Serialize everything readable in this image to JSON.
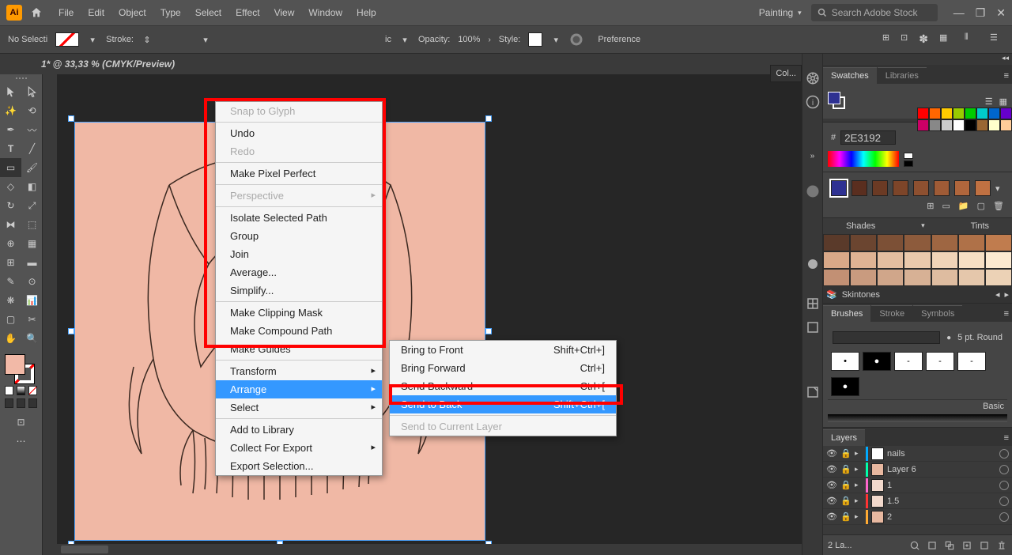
{
  "menubar": {
    "app_abbrev": "Ai",
    "menus": [
      "File",
      "Edit",
      "Object",
      "Type",
      "Select",
      "Effect",
      "View",
      "Window",
      "Help"
    ],
    "workspace": "Painting",
    "stock_placeholder": "Search Adobe Stock"
  },
  "control_bar": {
    "selection_label": "No Selecti",
    "stroke_label": "Stroke:",
    "opacity_label": "Opacity:",
    "opacity_value": "100%",
    "style_label": "Style:",
    "prefs_label": "Preference",
    "partial_ic": "ic"
  },
  "doc_tab": "1* @ 33,33 % (CMYK/Preview)",
  "context_menu": {
    "items": [
      {
        "label": "Snap to Glyph",
        "disabled": true
      },
      {
        "sep": true
      },
      {
        "label": "Undo"
      },
      {
        "label": "Redo",
        "disabled": true
      },
      {
        "sep": true
      },
      {
        "label": "Make Pixel Perfect"
      },
      {
        "sep": true
      },
      {
        "label": "Perspective",
        "disabled": true,
        "sub": true
      },
      {
        "sep": true
      },
      {
        "label": "Isolate Selected Path"
      },
      {
        "label": "Group"
      },
      {
        "label": "Join"
      },
      {
        "label": "Average..."
      },
      {
        "label": "Simplify..."
      },
      {
        "sep": true
      },
      {
        "label": "Make Clipping Mask"
      },
      {
        "label": "Make Compound Path"
      },
      {
        "label": "Make Guides"
      },
      {
        "sep": true
      },
      {
        "label": "Transform",
        "sub": true
      },
      {
        "label": "Arrange",
        "sub": true,
        "hl": true
      },
      {
        "label": "Select",
        "sub": true
      },
      {
        "sep": true
      },
      {
        "label": "Add to Library"
      },
      {
        "label": "Collect For Export",
        "sub": true
      },
      {
        "label": "Export Selection..."
      }
    ],
    "submenu": [
      {
        "label": "Bring to Front",
        "shortcut": "Shift+Ctrl+]"
      },
      {
        "label": "Bring Forward",
        "shortcut": "Ctrl+]"
      },
      {
        "label": "Send Backward",
        "shortcut": "Ctrl+["
      },
      {
        "label": "Send to Back",
        "shortcut": "Shift+Ctrl+[",
        "hl": true
      },
      {
        "sep": true
      },
      {
        "label": "Send to Current Layer",
        "disabled": true
      }
    ]
  },
  "color_tab_partial": "Col...",
  "panels": {
    "swatches": {
      "tab1": "Swatches",
      "tab2": "Libraries"
    },
    "color": {
      "hash": "#",
      "hex": "2E3192"
    },
    "gradient_colors": [
      "#2E3192",
      "#5a2e1f",
      "#6b3a24",
      "#7d4529",
      "#8e5030",
      "#9f5b36",
      "#b0663c",
      "#c07142"
    ],
    "shades": {
      "tab1": "Shades",
      "tab2": "Tints",
      "footer_label": "Skintones"
    },
    "brushes": {
      "tab1": "Brushes",
      "tab2": "Stroke",
      "tab3": "Symbols",
      "size": "5 pt. Round",
      "basic_label": "Basic"
    },
    "layers": {
      "tab": "Layers",
      "rows": [
        {
          "name": "nails",
          "color": "#00aaff",
          "thumb": "#fff"
        },
        {
          "name": "Layer 6",
          "color": "#00ffaa",
          "thumb": "#e8b8a0"
        },
        {
          "name": "1",
          "color": "#ff66cc",
          "thumb": "#f2d9cc"
        },
        {
          "name": "1.5",
          "color": "#ff3333",
          "thumb": "#f2d9cc"
        },
        {
          "name": "2",
          "color": "#ffaa33",
          "thumb": "#e8b8a0"
        }
      ],
      "footer_count": "2 La..."
    }
  },
  "swatch_colors": [
    [
      "#ff0000",
      "#ff6600",
      "#ffcc00",
      "#99cc00",
      "#00cc00",
      "#00cccc",
      "#0066cc",
      "#6600cc"
    ],
    [
      "#cc0066",
      "#888888",
      "#cccccc",
      "#ffffff",
      "#000000",
      "#996633",
      "#ffffcc",
      "#ffcc99"
    ]
  ],
  "shade_colors": [
    [
      "#5a3a2a",
      "#6b4530",
      "#7c5036",
      "#8d5b3c",
      "#9e6642",
      "#af7148",
      "#c07c4e"
    ],
    [
      "#d8a888",
      "#deb394",
      "#e4bea0",
      "#eac9ac",
      "#f0d4b8",
      "#f6dfc4",
      "#fce9d0"
    ],
    [
      "#c29074",
      "#c99b7f",
      "#d0a68a",
      "#d7b195",
      "#debca0",
      "#e5c7ab",
      "#ecd2b6"
    ]
  ]
}
